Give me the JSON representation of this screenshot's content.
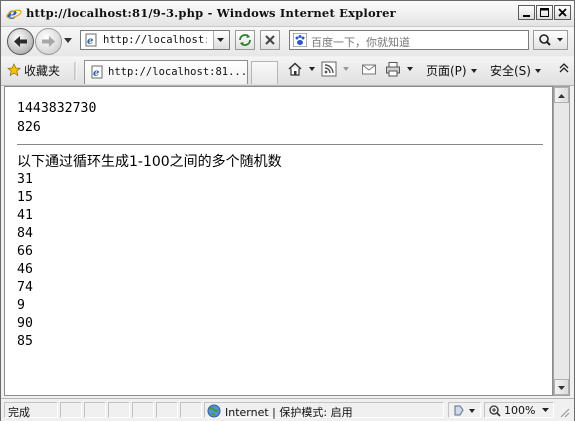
{
  "window": {
    "title": "http://localhost:81/9-3.php - Windows Internet Explorer"
  },
  "address_bar": {
    "url": "http://localhost:81/9-3.php",
    "search_placeholder": "百度一下，你就知道"
  },
  "tabs": {
    "favorites_label": "收藏夹",
    "active_tab_label": "http://localhost:81...",
    "page_menu_label": "页面(P)",
    "safety_menu_label": "安全(S)"
  },
  "content": {
    "timestamp": "1443832730",
    "microseconds": "826",
    "heading": "以下通过循环生成1-100之间的多个随机数",
    "numbers": [
      "31",
      "15",
      "41",
      "84",
      "66",
      "46",
      "74",
      "9",
      "90",
      "85"
    ]
  },
  "status_bar": {
    "status_text": "完成",
    "zone_text": "Internet | 保护模式: 启用",
    "zoom": "100%"
  },
  "icons": {
    "ie_logo": "ie-logo-icon",
    "back": "back-arrow-icon",
    "forward": "forward-arrow-icon",
    "refresh": "refresh-icon",
    "stop": "stop-icon",
    "search": "magnifier-icon",
    "home": "home-icon",
    "feeds": "rss-icon",
    "mail": "mail-icon",
    "print": "printer-icon",
    "globe": "globe-icon"
  },
  "colors": {
    "accent": "#3a6ea5",
    "chrome": "#f0f0f0"
  }
}
